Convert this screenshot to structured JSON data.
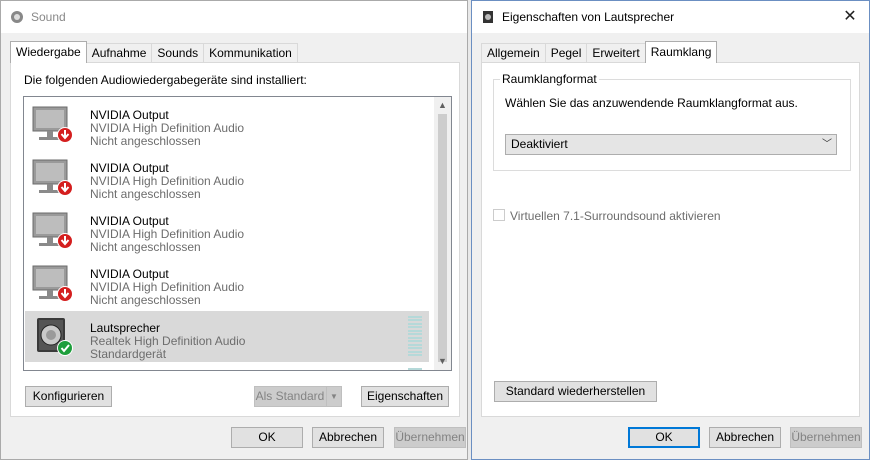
{
  "sound_window": {
    "title": "Sound",
    "tabs": [
      "Wiedergabe",
      "Aufnahme",
      "Sounds",
      "Kommunikation"
    ],
    "active_tab": "Wiedergabe",
    "instruction": "Die folgenden Audiowiedergabegeräte sind installiert:",
    "devices": [
      {
        "name": "NVIDIA Output",
        "driver": "NVIDIA High Definition Audio",
        "status": "Nicht angeschlossen",
        "icon": "monitor-disconnected-icon"
      },
      {
        "name": "NVIDIA Output",
        "driver": "NVIDIA High Definition Audio",
        "status": "Nicht angeschlossen",
        "icon": "monitor-disconnected-icon"
      },
      {
        "name": "NVIDIA Output",
        "driver": "NVIDIA High Definition Audio",
        "status": "Nicht angeschlossen",
        "icon": "monitor-disconnected-icon"
      },
      {
        "name": "NVIDIA Output",
        "driver": "NVIDIA High Definition Audio",
        "status": "Nicht angeschlossen",
        "icon": "monitor-disconnected-icon"
      },
      {
        "name": "Lautsprecher",
        "driver": "Realtek High Definition Audio",
        "status": "Standardgerät",
        "icon": "speaker-default-icon",
        "selected": true
      }
    ],
    "buttons": {
      "configure": "Konfigurieren",
      "set_default": "Als Standard",
      "properties": "Eigenschaften",
      "ok": "OK",
      "cancel": "Abbrechen",
      "apply": "Übernehmen"
    }
  },
  "props_window": {
    "title": "Eigenschaften von Lautsprecher",
    "tabs": [
      "Allgemein",
      "Pegel",
      "Erweitert",
      "Raumklang"
    ],
    "active_tab": "Raumklang",
    "group_title": "Raumklangformat",
    "description": "Wählen Sie das anzuwendende Raumklangformat aus.",
    "format_selected": "Deaktiviert",
    "checkbox_label": "Virtuellen 7.1-Surroundsound aktivieren",
    "checkbox_checked": false,
    "buttons": {
      "restore": "Standard wiederherstellen",
      "ok": "OK",
      "cancel": "Abbrechen",
      "apply": "Übernehmen"
    }
  },
  "colors": {
    "accent": "#0078d7",
    "disconnected": "#d41e1e",
    "default_ok": "#1e9e3c"
  }
}
